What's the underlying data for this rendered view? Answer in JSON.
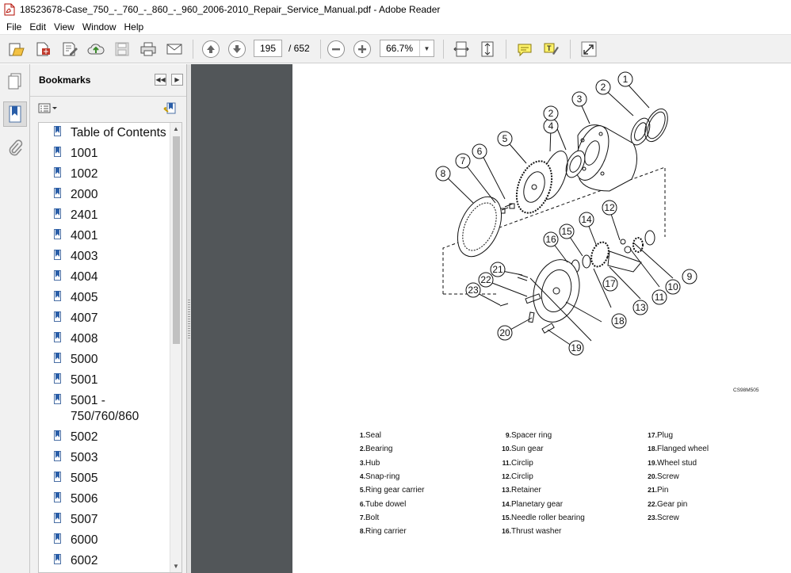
{
  "window": {
    "title": "18523678-Case_750_-_760_-_860_-_960_2006-2010_Repair_Service_Manual.pdf - Adobe Reader"
  },
  "menu": [
    "File",
    "Edit",
    "View",
    "Window",
    "Help"
  ],
  "toolbar": {
    "current_page": "195",
    "page_total": "/ 652",
    "zoom": "66.7%",
    "icons": [
      "open-icon",
      "create-pdf-icon",
      "edit-icon",
      "cloud-upload-icon",
      "save-icon",
      "print-icon",
      "email-icon",
      "previous-page-icon",
      "next-page-icon",
      "zoom-out-icon",
      "zoom-in-icon",
      "fit-width-icon",
      "fit-page-icon",
      "comment-icon",
      "highlight-icon",
      "expand-icon"
    ]
  },
  "bookmarks": {
    "title": "Bookmarks",
    "items": [
      "Table of Contents",
      "1001",
      "1002",
      "2000",
      "2401",
      "4001",
      "4003",
      "4004",
      "4005",
      "4007",
      "4008",
      "5000",
      "5001",
      "5001 -\n750/760/860",
      "5002",
      "5003",
      "5005",
      "5006",
      "5007",
      "6000",
      "6002"
    ]
  },
  "document": {
    "figure_code": "CS98M505",
    "callouts": [
      "1",
      "2",
      "3",
      "4",
      "2",
      "5",
      "6",
      "7",
      "8",
      "12",
      "14",
      "15",
      "16",
      "21",
      "22",
      "23",
      "17",
      "11",
      "10",
      "9",
      "13",
      "18",
      "20",
      "19"
    ],
    "legend": [
      {
        "n": "1.",
        "t": "Seal"
      },
      {
        "n": "2.",
        "t": "Bearing"
      },
      {
        "n": "3.",
        "t": "Hub"
      },
      {
        "n": "4.",
        "t": "Snap-ring"
      },
      {
        "n": "5.",
        "t": "Ring gear carrier"
      },
      {
        "n": "6.",
        "t": "Tube dowel"
      },
      {
        "n": "7.",
        "t": "Bolt"
      },
      {
        "n": "8.",
        "t": "Ring carrier"
      },
      {
        "n": "9.",
        "t": "Spacer ring"
      },
      {
        "n": "10.",
        "t": "Sun gear"
      },
      {
        "n": "11.",
        "t": "Circlip"
      },
      {
        "n": "12.",
        "t": "Circlip"
      },
      {
        "n": "13.",
        "t": "Retainer"
      },
      {
        "n": "14.",
        "t": "Planetary gear"
      },
      {
        "n": "15.",
        "t": "Needle roller bearing"
      },
      {
        "n": "16.",
        "t": "Thrust washer"
      },
      {
        "n": "17.",
        "t": "Plug"
      },
      {
        "n": "18.",
        "t": "Flanged wheel"
      },
      {
        "n": "19.",
        "t": "Wheel stud"
      },
      {
        "n": "20.",
        "t": "Screw"
      },
      {
        "n": "21.",
        "t": "Pin"
      },
      {
        "n": "22.",
        "t": "Gear pin"
      },
      {
        "n": "23.",
        "t": "Screw"
      }
    ]
  }
}
